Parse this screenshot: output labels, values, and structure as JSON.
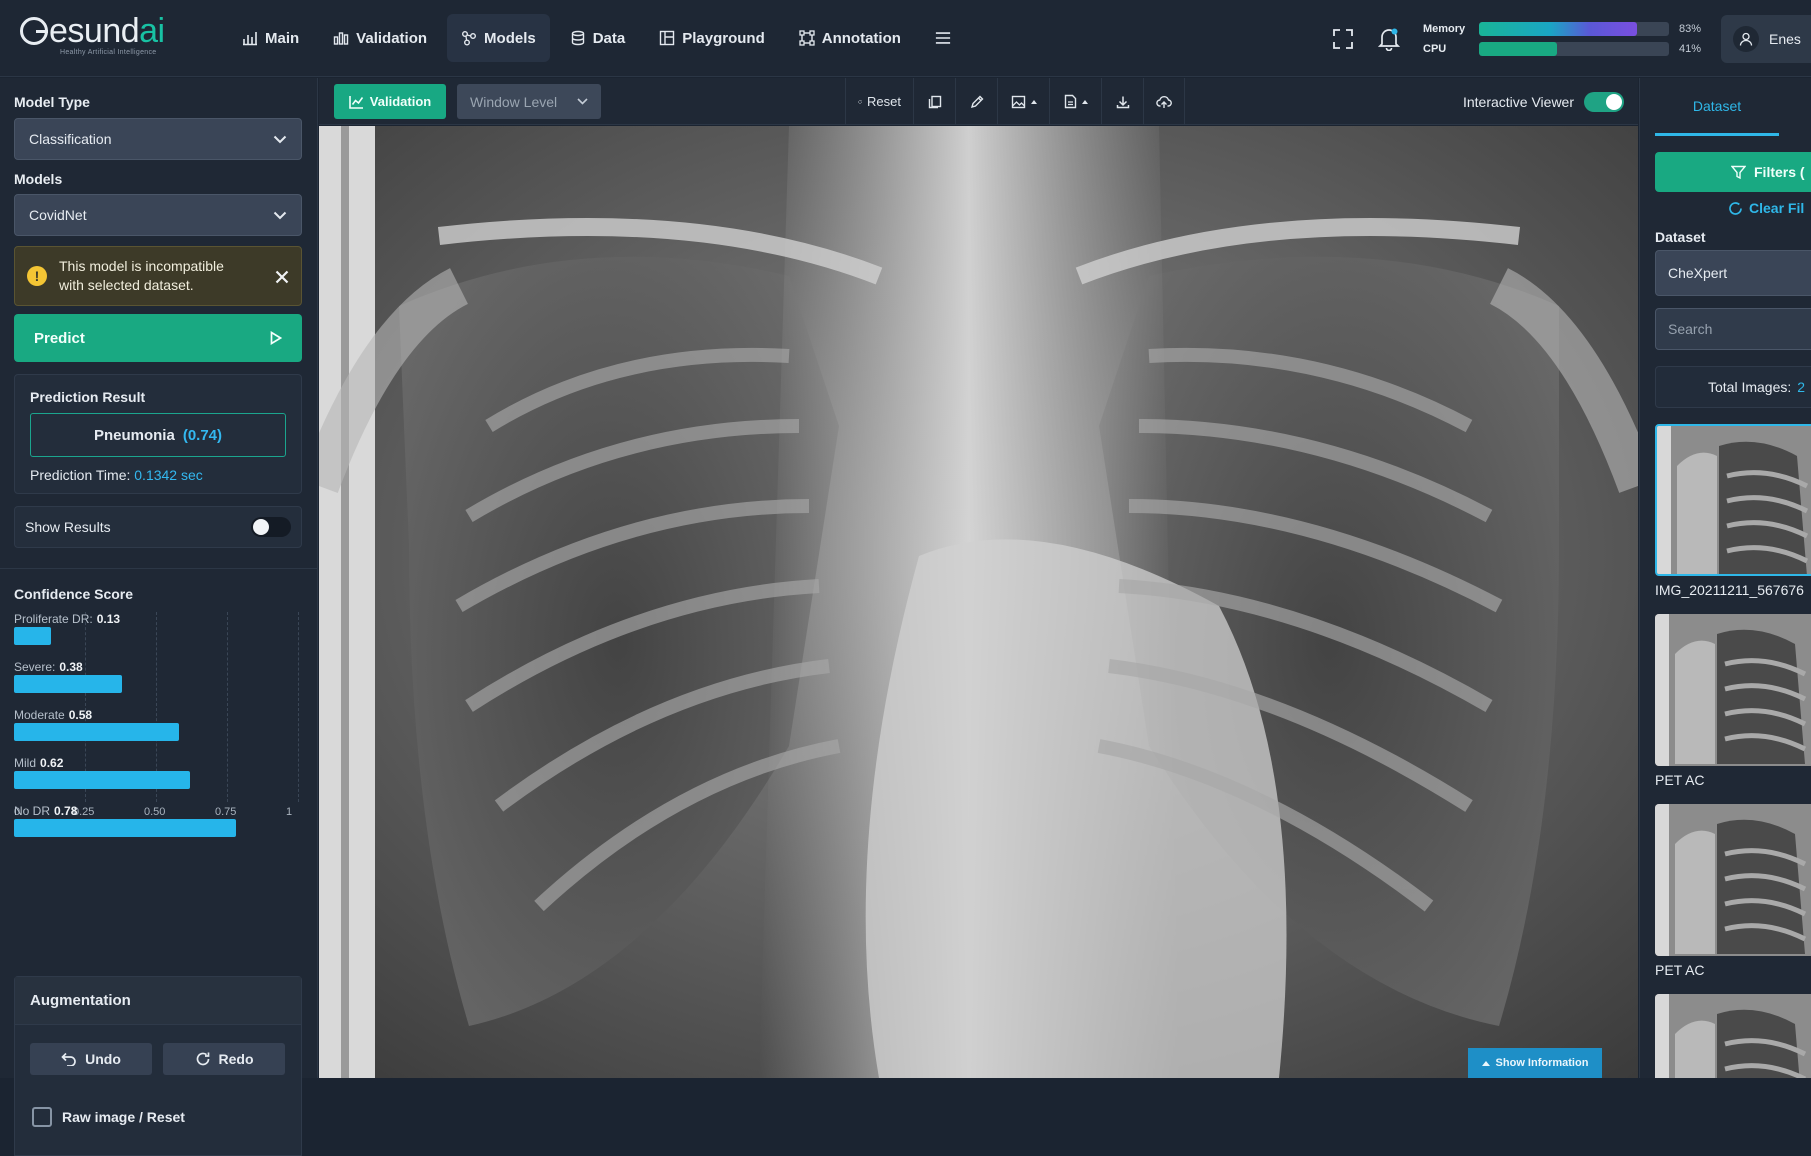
{
  "logo": {
    "main": "esund",
    "accent": "ai",
    "tagline": "Healthy Artificial Intelligence"
  },
  "nav": {
    "items": [
      {
        "label": "Main"
      },
      {
        "label": "Validation"
      },
      {
        "label": "Models"
      },
      {
        "label": "Data"
      },
      {
        "label": "Playground"
      },
      {
        "label": "Annotation"
      }
    ],
    "active": "Models"
  },
  "system": {
    "memory": {
      "label": "Memory",
      "value_text": "83%",
      "value": 0.83
    },
    "cpu": {
      "label": "CPU",
      "value_text": "41%",
      "value": 0.41
    }
  },
  "user": {
    "name": "Enes"
  },
  "left_panel": {
    "model_type_label": "Model Type",
    "model_type_value": "Classification",
    "models_label": "Models",
    "models_value": "CovidNet",
    "warning_line1": "This model is incompatible",
    "warning_line2": "with selected dataset.",
    "predict_label": "Predict",
    "result_title": "Prediction Result",
    "result_class": "Pneumonia",
    "result_score": "(0.74)",
    "prediction_time_label": "Prediction Time:",
    "prediction_time_value": "0.1342 sec",
    "show_results_label": "Show Results",
    "confidence_title": "Confidence Score",
    "augmentation_title": "Augmentation",
    "undo_label": "Undo",
    "redo_label": "Redo",
    "raw_image_label": "Raw image / Reset"
  },
  "chart_data": {
    "type": "bar",
    "orientation": "horizontal",
    "title": "Confidence Score",
    "categories": [
      "Proliferate DR:",
      "Severe:",
      "Moderate",
      "Mild",
      "No DR"
    ],
    "values": [
      0.13,
      0.38,
      0.58,
      0.62,
      0.78
    ],
    "value_labels": [
      "0.13",
      "0.38",
      "0.58",
      "0.62",
      "0.78"
    ],
    "xlim": [
      0,
      1
    ],
    "x_ticks": [
      "0",
      "0.25",
      "0.50",
      "0.75",
      "1"
    ],
    "grid": true,
    "bar_color": "#26b5ea"
  },
  "toolbar": {
    "validation_label": "Validation",
    "window_level_label": "Window Level",
    "reset_label": "Reset",
    "interactive_viewer_label": "Interactive Viewer"
  },
  "viewer": {
    "show_information_label": "Show Information"
  },
  "right_panel": {
    "tab_label": "Dataset",
    "filters_label": "Filters (",
    "clear_filters_label": "Clear Fil",
    "dataset_label": "Dataset",
    "dataset_value": "CheXpert",
    "search_placeholder": "Search",
    "total_images_label": "Total Images:",
    "total_images_value": "2",
    "thumbnails": [
      {
        "caption": "IMG_20211211_567676"
      },
      {
        "caption": "PET AC"
      },
      {
        "caption": "PET AC"
      },
      {
        "caption": ""
      }
    ]
  },
  "colors": {
    "accent_green": "#19a982",
    "accent_blue": "#2fb7e8",
    "background": "#1b2431",
    "panel": "#1f2835"
  }
}
